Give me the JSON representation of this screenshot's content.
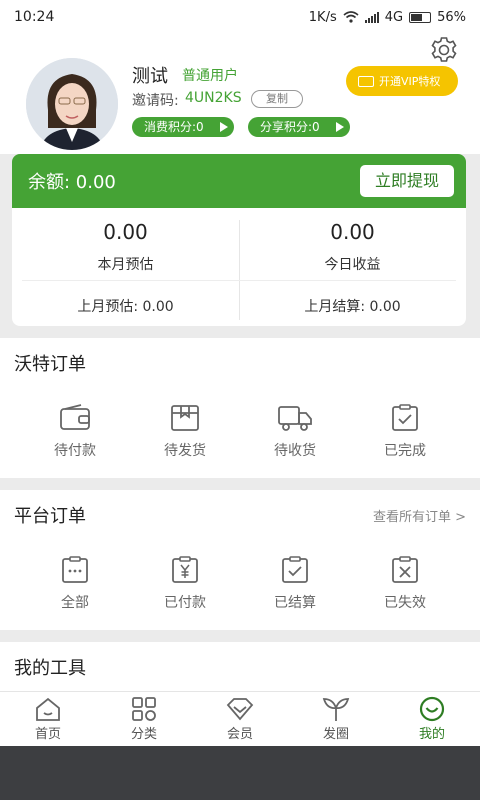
{
  "status_bar": {
    "time": "10:24",
    "speed": "1K/s",
    "network": "4G",
    "battery": "56%"
  },
  "profile": {
    "name": "测试",
    "user_type": "普通用户",
    "invite_label": "邀请码:",
    "invite_code": "4UN2KS",
    "copy_label": "复制",
    "consume_points": "消费积分:0",
    "share_points": "分享积分:0",
    "vip_label": "开通VIP特权"
  },
  "balance": {
    "text": "余额: 0.00",
    "withdraw_label": "立即提现"
  },
  "stats": {
    "left": {
      "value": "0.00",
      "label": "本月预估",
      "sub": "上月预估: 0.00"
    },
    "right": {
      "value": "0.00",
      "label": "今日收益",
      "sub": "上月结算: 0.00"
    }
  },
  "wote_orders": {
    "title": "沃特订单",
    "items": [
      {
        "label": "待付款",
        "icon": "wallet-icon"
      },
      {
        "label": "待发货",
        "icon": "package-icon"
      },
      {
        "label": "待收货",
        "icon": "truck-icon"
      },
      {
        "label": "已完成",
        "icon": "clipboard-check-icon"
      }
    ]
  },
  "platform_orders": {
    "title": "平台订单",
    "link": "查看所有订单 >",
    "items": [
      {
        "label": "全部",
        "icon": "clipboard-dots-icon"
      },
      {
        "label": "已付款",
        "icon": "clipboard-yen-icon"
      },
      {
        "label": "已结算",
        "icon": "clipboard-check-icon"
      },
      {
        "label": "已失效",
        "icon": "clipboard-x-icon"
      }
    ]
  },
  "tools": {
    "title": "我的工具"
  },
  "tabs": [
    {
      "label": "首页",
      "icon": "home-icon"
    },
    {
      "label": "分类",
      "icon": "grid-icon"
    },
    {
      "label": "会员",
      "icon": "diamond-icon"
    },
    {
      "label": "发圈",
      "icon": "sprout-icon"
    },
    {
      "label": "我的",
      "icon": "smile-icon"
    }
  ],
  "colors": {
    "brand": "#45a335",
    "vip": "#f5c400",
    "page_bg": "#ebebeb"
  }
}
